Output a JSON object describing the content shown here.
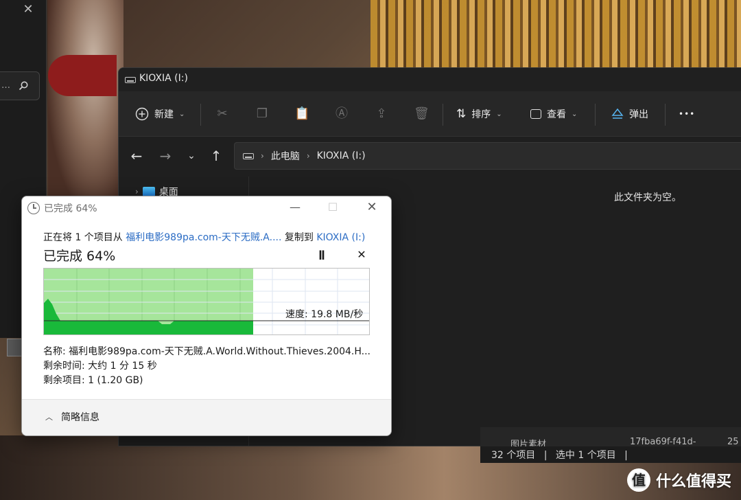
{
  "explorer": {
    "title": "KIOXIA (I:)",
    "toolbar": {
      "new_label": "新建",
      "sort_label": "排序",
      "view_label": "查看",
      "eject_label": "弹出",
      "more_label": "•••"
    },
    "breadcrumb": [
      "此电脑",
      "KIOXIA (I:)"
    ],
    "sidebar": {
      "items": [
        {
          "label": "桌面"
        }
      ]
    },
    "empty_message": "此文件夹为空。",
    "status": {
      "item_count": "32 个项目",
      "selected": "选中 1 个项目",
      "thumb_label_1": "图片素材",
      "thumb_label_2": "17fba69f-f41d-",
      "thumb_label_3": "25"
    }
  },
  "dialog": {
    "title": "已完成 64%",
    "line1_prefix": "正在将 1 个项目从",
    "source": "福利电影989pa.com-天下无贼.A....",
    "line1_mid": "复制到",
    "destination": "KIOXIA (I:)",
    "percent_label": "已完成 64%",
    "progress": 0.64,
    "speed_label": "速度: 19.8 MB/秒",
    "name_line": "名称:  福利电影989pa.com-天下无贼.A.World.Without.Thieves.2004.H...",
    "time_line": "剩余时间:  大约 1 分 15 秒",
    "items_line": "剩余项目:  1 (1.20 GB)",
    "less_info_label": "简略信息"
  },
  "brand": {
    "name": "什么值得买",
    "logo_char": "值"
  },
  "colors": {
    "graph_fill": "#19b93a",
    "graph_bg_done": "#a6e59b",
    "link": "#2b6cc4"
  }
}
